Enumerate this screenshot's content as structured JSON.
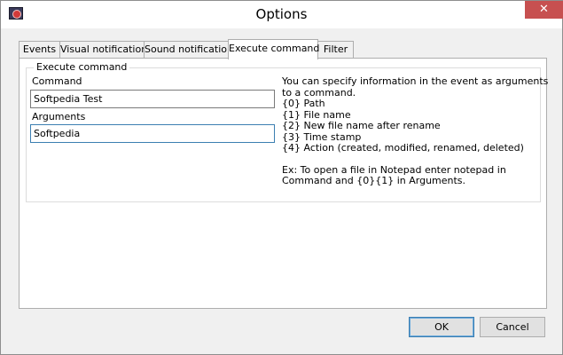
{
  "window": {
    "title": "Options",
    "close_glyph": "✕"
  },
  "tabs": [
    {
      "label": "Events",
      "active": false
    },
    {
      "label": "Visual notification",
      "active": false
    },
    {
      "label": "Sound notification",
      "active": false
    },
    {
      "label": "Execute command",
      "active": true
    },
    {
      "label": "Filter",
      "active": false
    }
  ],
  "execute": {
    "group_label": "Execute command",
    "command_label": "Command",
    "command_value": "Softpedia Test",
    "arguments_label": "Arguments",
    "arguments_value": "Softpedia",
    "help_lines": [
      "You can specify information in the event as arguments",
      "to a command.",
      "{0} Path",
      "{1} File name",
      "{2} New file name after rename",
      "{3} Time stamp",
      "{4} Action (created, modified, renamed, deleted)"
    ],
    "example_lines": [
      "Ex: To open a file in Notepad enter notepad in",
      "Command and {0}{1} in Arguments."
    ]
  },
  "buttons": {
    "ok_label": "OK",
    "cancel_label": "Cancel"
  }
}
